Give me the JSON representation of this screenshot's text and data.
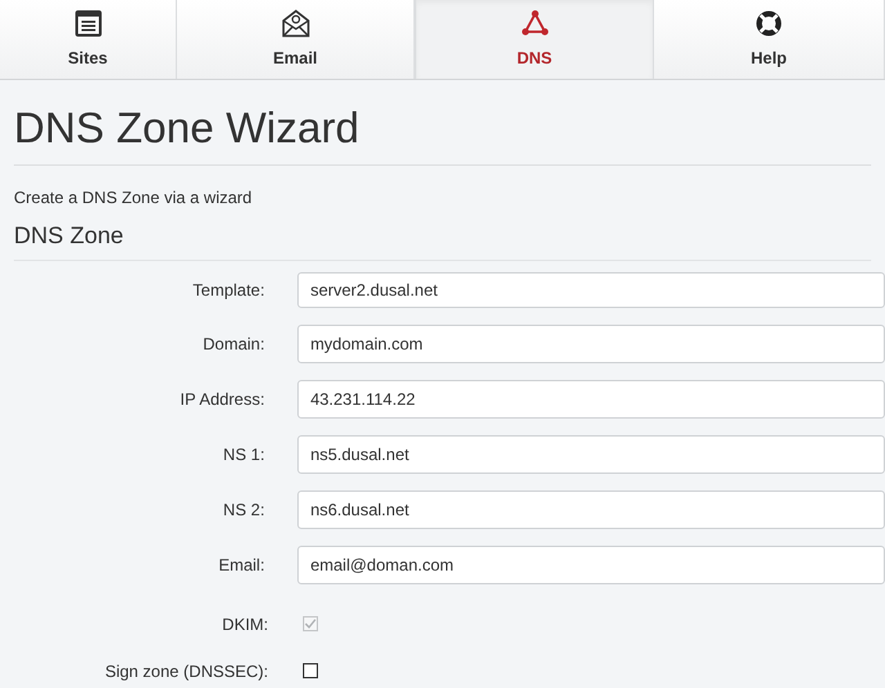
{
  "tabs": [
    {
      "label": "Sites",
      "selected": false
    },
    {
      "label": "Email",
      "selected": false
    },
    {
      "label": "DNS",
      "selected": true
    },
    {
      "label": "Help",
      "selected": false
    }
  ],
  "title": "DNS Zone Wizard",
  "description": "Create a DNS Zone via a wizard",
  "section": "DNS Zone",
  "fields": [
    {
      "kind": "select",
      "label": "Template:",
      "value": "server2.dusal.net"
    },
    {
      "kind": "text",
      "label": "Domain:",
      "value": "mydomain.com"
    },
    {
      "kind": "text",
      "label": "IP Address:",
      "value": "43.231.114.22"
    },
    {
      "kind": "text",
      "label": "NS 1:",
      "value": "ns5.dusal.net"
    },
    {
      "kind": "text",
      "label": "NS 2:",
      "value": "ns6.dusal.net"
    },
    {
      "kind": "text",
      "label": "Email:",
      "value": "email@doman.com"
    },
    {
      "kind": "checkbox",
      "label": "DKIM:",
      "checked": true,
      "disabled": true
    },
    {
      "kind": "checkbox",
      "label": "Sign zone (DNSSEC):",
      "checked": false
    }
  ]
}
